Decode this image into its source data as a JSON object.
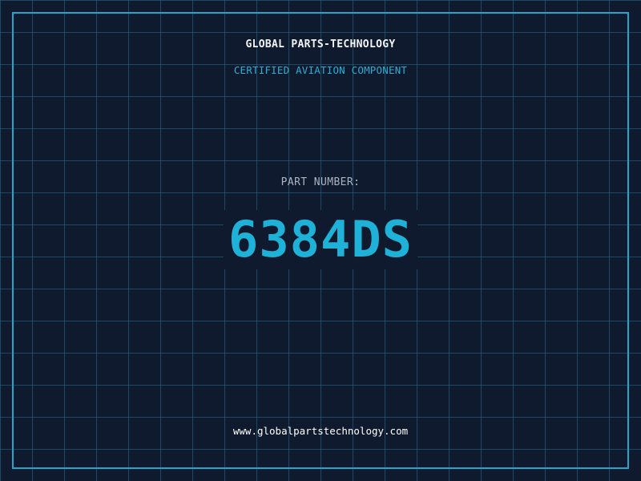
{
  "header": {
    "company_name": "GLOBAL PARTS-TECHNOLOGY",
    "subtitle": "CERTIFIED AVIATION COMPONENT"
  },
  "part": {
    "label": "PART NUMBER:",
    "number": "6384DS"
  },
  "footer": {
    "website": "www.globalpartstechnology.com"
  },
  "colors": {
    "background": "#101a2e",
    "grid": "#266e8c",
    "accent": "#1fb2d8",
    "frame": "#1fa6cc",
    "title_text": "#f2f4f6",
    "label_text": "#aab4c0"
  }
}
